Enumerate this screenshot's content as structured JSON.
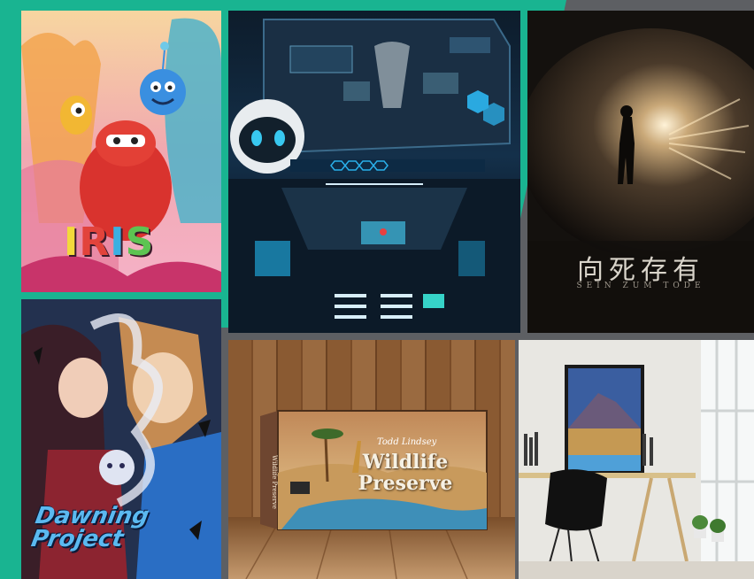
{
  "colors": {
    "background": "#19b491",
    "accent_grey": "#5d5f63"
  },
  "panels": {
    "iris": {
      "title_letters": [
        "I",
        "R",
        "I",
        "S"
      ],
      "letter_colors": [
        "#f3d93b",
        "#e2433b",
        "#3bb0e2",
        "#5dc452"
      ]
    },
    "horror": {
      "title": "向死存有",
      "subtitle": "SEIN ZUM TODE"
    },
    "anime": {
      "title": "Dawning Project"
    },
    "wildlife": {
      "author": "Todd Lindsey",
      "title_line1": "Wildlife",
      "title_line2": "Preserve",
      "spine": "Wildlife Preserve"
    }
  }
}
